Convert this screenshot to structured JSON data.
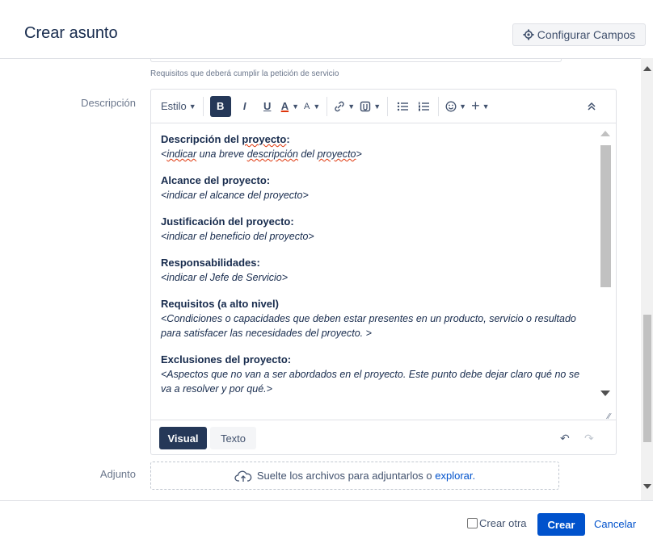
{
  "header": {
    "title": "Crear asunto",
    "config_button": "Configurar Campos",
    "config_icon": "gear-icon"
  },
  "requirements_help": "Requisitos que deberá cumplir la petición de servicio",
  "description": {
    "label": "Descripción",
    "toolbar": {
      "style": "Estilo",
      "bold": "B",
      "italic": "I",
      "underline": "U",
      "text_color": "A",
      "more_formatting": "A",
      "link_icon": "link-icon",
      "attachment_icon": "attachment-icon",
      "bullet_list_icon": "bullet-list-icon",
      "numbered_list_icon": "numbered-list-icon",
      "emoji_icon": "emoji-icon",
      "insert": "+",
      "collapse_icon": "collapse-icon"
    },
    "sections": [
      {
        "title": "Descripción del proyecto:",
        "text": "<indicar una breve descripción del proyecto>"
      },
      {
        "title": "Alcance del proyecto:",
        "text": "<indicar el alcance del proyecto>"
      },
      {
        "title": "Justificación del proyecto:",
        "text": "<indicar el beneficio del proyecto>"
      },
      {
        "title": "Responsabilidades:",
        "text": "<indicar el Jefe de Servicio>"
      },
      {
        "title": "Requisitos (a alto nivel)",
        "text": "<Condiciones o capacidades que deben estar presentes en un producto, servicio o resultado para satisfacer las necesidades del proyecto. >"
      },
      {
        "title": "Exclusiones del proyecto:",
        "text": "<Aspectos que no van a ser abordados en el proyecto. Este punto debe dejar claro qué no se va a resolver y por qué.>"
      }
    ],
    "modes": {
      "visual": "Visual",
      "text": "Texto"
    }
  },
  "attachment": {
    "label": "Adjunto",
    "drop_text": "Suelte los archivos para adjuntarlos o ",
    "browse_link": "explorar.",
    "icon": "cloud-upload-icon"
  },
  "footer": {
    "create_another": "Crear otra",
    "create": "Crear",
    "cancel": "Cancelar"
  }
}
